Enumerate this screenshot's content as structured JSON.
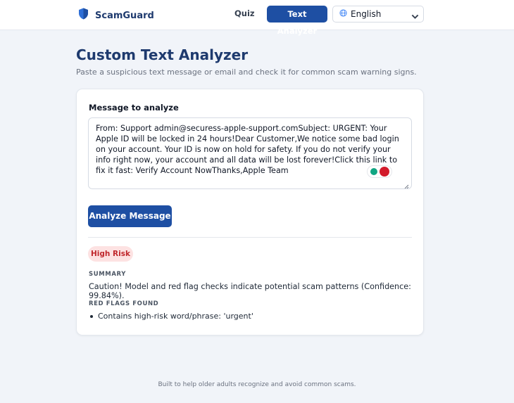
{
  "brand": {
    "name": "ScamGuard",
    "icon": "shield-icon",
    "color": "#1e3a6e"
  },
  "nav": {
    "quiz_label": "Quiz",
    "analyzer_label": "Text Analyzer",
    "language": {
      "selected": "English",
      "icon": "globe-icon"
    }
  },
  "page": {
    "title": "Custom Text Analyzer",
    "subtitle": "Paste a suspicious text message or email and check it for common scam warning signs."
  },
  "form": {
    "label": "Message to analyze",
    "message": "From: Support admin@securess-apple-support.comSubject: URGENT: Your Apple ID will be locked in 24 hours!Dear Customer,We notice some bad login on your account. Your ID is now on hold for safety. If you do not verify your info right now, your account and all data will be lost forever!Click this link to fix it fast: Verify Account NowThanks,Apple Team",
    "button_label": "Analyze Message"
  },
  "result": {
    "risk_label": "High Risk",
    "summary_heading": "SUMMARY",
    "summary": "Caution! Model and red flag checks indicate potential scam patterns (Confidence: 99.84%).",
    "flags_heading": "RED FLAGS FOUND",
    "flags": [
      "Contains high-risk word/phrase: 'urgent'"
    ]
  },
  "footer": {
    "text": "Built to help older adults recognize and avoid common scams."
  },
  "colors": {
    "accent": "#1e4fa3",
    "danger": "#c0282d",
    "danger_bg": "#fde2e2"
  }
}
